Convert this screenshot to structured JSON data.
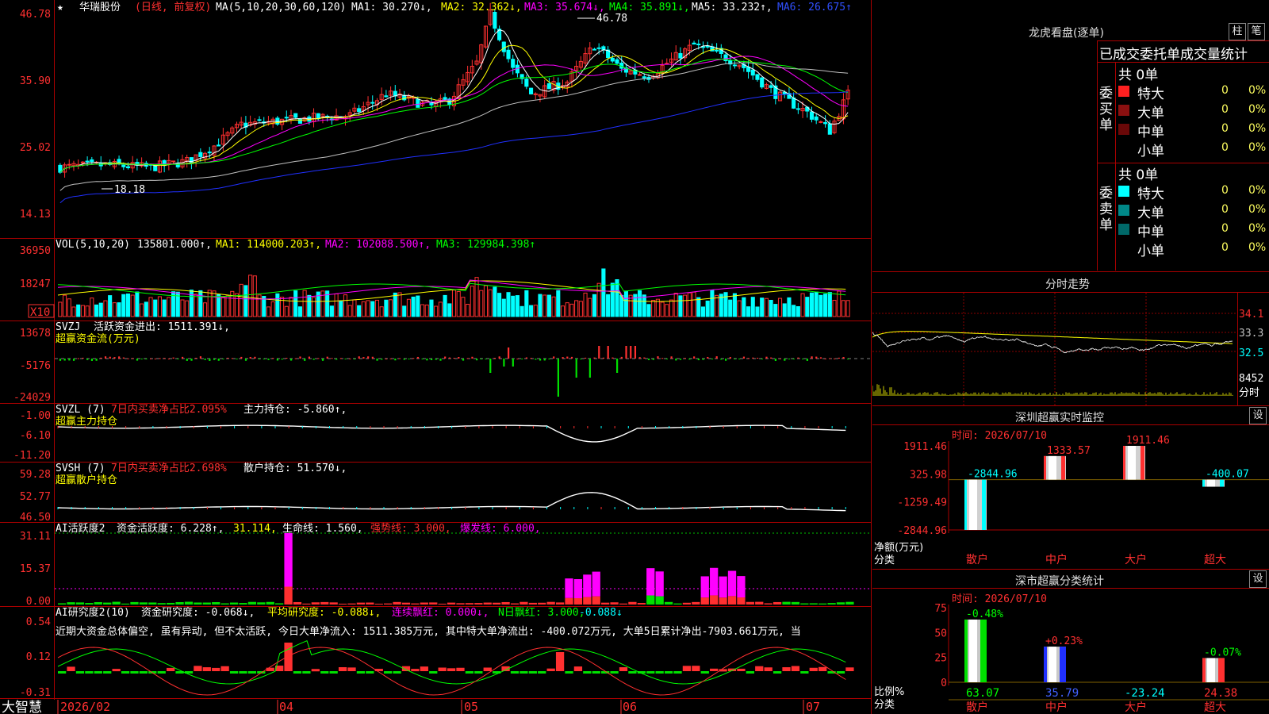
{
  "stock": {
    "name": "华瑞股份",
    "mode": "(日线, 前复权)",
    "ma_label": "MA(5,10,20,30,60,120)",
    "ma1": "MA1: 30.270↓,",
    "ma2": "MA2: 32.362↓,",
    "ma3": "MA3: 35.674↓,",
    "ma4": "MA4: 35.891↓,",
    "ma5": "MA5: 33.232↑,",
    "ma6": "MA6: 26.675↑",
    "high_label": "46.78",
    "low_label": "18.18",
    "star": "★"
  },
  "price_axis": [
    "46.78",
    "35.90",
    "25.02",
    "14.13"
  ],
  "vol": {
    "label": "VOL(5,10,20)",
    "value": "135801.000↑,",
    "ma1": "MA1: 114000.203↑,",
    "ma2": "MA2: 102088.500↑,",
    "ma3": "MA3: 129984.398↑",
    "axis": [
      "36950",
      "18247"
    ],
    "unit": "X10"
  },
  "svzj": {
    "label": "SVZJ",
    "desc": "活跃资金进出: 1511.391↓,",
    "sub": "超赢资金流(万元)",
    "axis": [
      "13678",
      "-5176",
      "-24029"
    ]
  },
  "svzl": {
    "label": "SVZL (7)",
    "pct": "7日内买卖净占比2.095%",
    "main": "主力持仓: -5.860↑,",
    "sub": "超赢主力持仓",
    "axis": [
      "-1.00",
      "-6.10",
      "-11.20"
    ]
  },
  "svsh": {
    "label": "SVSH (7)",
    "pct": "7日内买卖净占比2.698%",
    "retail": "散户持仓: 51.570↓,",
    "sub": "超赢散户持仓",
    "axis": [
      "59.28",
      "52.77",
      "46.50"
    ]
  },
  "ai1": {
    "label": "AI活跃度2",
    "act": "资金活跃度: 6.228↑,",
    "val2": "31.114,",
    "life": "生命线: 1.560,",
    "strong": "强势线: 3.000,",
    "burst": "爆发线: 6.000,",
    "axis": [
      "31.11",
      "15.37",
      "0.00"
    ]
  },
  "ai2": {
    "label": "AI研究度2(10)",
    "research": "资金研究度: -0.068↓,",
    "avg": "平均研究度: -0.088↓,",
    "cont": "连续飘红: 0.000↓,",
    "nday": "N日飘红: 3.000,",
    "nval": "-0.088↓",
    "commentary": "近期大资金总体偏空, 虽有异动, 但不太活跃, 今日大单净流入: 1511.385万元, 其中特大单净流出: -400.072万元, 大单5日累计净出-7903.661万元, 当",
    "axis": [
      "0.54",
      "0.12",
      "-0.31"
    ]
  },
  "date_axis": [
    "2026/02",
    "04",
    "05",
    "06",
    "07"
  ],
  "brand": "大智慧",
  "right": {
    "title": "龙虎看盘(逐单)",
    "btn1": "柱",
    "btn2": "笔",
    "table_title": "已成交委托单成交量统计",
    "buy_side": "委买单",
    "sell_side": "委卖单",
    "buy_total": "共 0单",
    "sell_total": "共 0单",
    "buy_rows": [
      {
        "label": "特大",
        "val": "0",
        "pct": "0%",
        "color": "#ff2020"
      },
      {
        "label": "大单",
        "val": "0",
        "pct": "0%",
        "color": "#8a1010"
      },
      {
        "label": "中单",
        "val": "0",
        "pct": "0%",
        "color": "#6a0808"
      },
      {
        "label": "小单",
        "val": "0",
        "pct": "0%",
        "color": ""
      }
    ],
    "sell_rows": [
      {
        "label": "特大",
        "val": "0",
        "pct": "0%",
        "color": "#00ffff"
      },
      {
        "label": "大单",
        "val": "0",
        "pct": "0%",
        "color": "#008888"
      },
      {
        "label": "中单",
        "val": "0",
        "pct": "0%",
        "color": "#006868"
      },
      {
        "label": "小单",
        "val": "0",
        "pct": "0%",
        "color": ""
      }
    ],
    "intraday_title": "分时走势",
    "intraday_axis": [
      "34.1",
      "33.3",
      "32.5",
      "8452",
      "分时"
    ],
    "monitor_title": "深圳超赢实时监控",
    "monitor_time": "时间: 2026/07/10",
    "monitor_btn": "设",
    "monitor_axis": [
      "1911.46",
      "325.98",
      "-1259.49",
      "-2844.96"
    ],
    "monitor_ylabel": "净额(万元)",
    "monitor_xlabel": "分类",
    "monitor_bars": [
      {
        "cat": "散户",
        "value": -2844.96,
        "label": "-2844.96",
        "color": "#00ffff"
      },
      {
        "cat": "中户",
        "value": 1333.57,
        "label": "1333.57",
        "color": "#ff3030"
      },
      {
        "cat": "大户",
        "value": 1911.46,
        "label": "1911.46",
        "color": "#ff3030"
      },
      {
        "cat": "超大",
        "value": -400.07,
        "label": "-400.07",
        "color": "#00ffff"
      }
    ],
    "class_title": "深市超赢分类统计",
    "class_time": "时间: 2026/07/10",
    "class_btn": "设",
    "class_axis": [
      "75",
      "50",
      "25",
      "0"
    ],
    "class_ylabel": "比例%",
    "class_xlabel": "分类",
    "class_bars": [
      {
        "cat": "散户",
        "value": 63.07,
        "label": "63.07",
        "top": "-0.48%",
        "color": "#00e000",
        "topcolor": "#00ff00",
        "labelcolor": "#00ff00"
      },
      {
        "cat": "中户",
        "value": 35.79,
        "label": "35.79",
        "top": "+0.23%",
        "color": "#2030ff",
        "topcolor": "#ff3030",
        "labelcolor": "#4060ff"
      },
      {
        "cat": "大户",
        "value": -23.24,
        "label": "-23.24",
        "top": "",
        "color": "#00ffff",
        "topcolor": "#00ffff",
        "labelcolor": "#00ffff"
      },
      {
        "cat": "超大",
        "value": 24.38,
        "label": "24.38",
        "top": "-0.07%",
        "color": "#ff3030",
        "topcolor": "#00ff00",
        "labelcolor": "#ff3030"
      }
    ]
  },
  "colors": {
    "up": "#ff3030",
    "down": "#00ffff",
    "ma1": "#ffffff",
    "ma2": "#ffff00",
    "ma3": "#ff00ff",
    "ma4": "#00ff00",
    "ma5": "#c0c0c0",
    "ma6": "#2030ff",
    "axis": "#ff0000",
    "grid": "#800000"
  }
}
